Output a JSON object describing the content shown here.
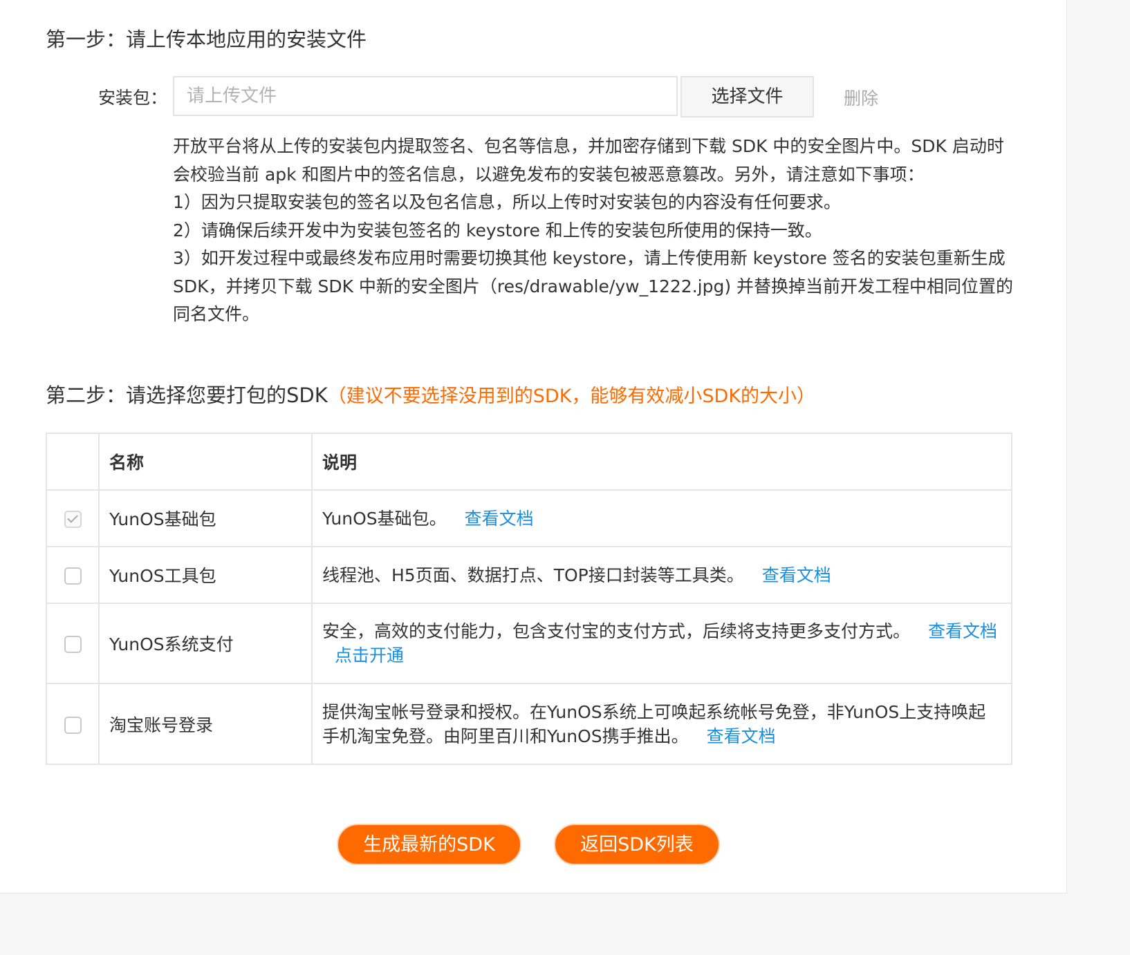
{
  "step1": {
    "title": "第一步：请上传本地应用的安装文件"
  },
  "upload": {
    "label": "安装包：",
    "placeholder": "请上传文件",
    "choose_label": "选择文件",
    "delete_label": "删除"
  },
  "description": {
    "intro": "开放平台将从上传的安装包内提取签名、包名等信息，并加密存储到下载 SDK 中的安全图片中。SDK 启动时会校验当前 apk 和图片中的签名信息，以避免发布的安装包被恶意篡改。另外，请注意如下事项：",
    "item1": "1）因为只提取安装包的签名以及包名信息，所以上传时对安装包的内容没有任何要求。",
    "item2": "2）请确保后续开发中为安装包签名的 keystore 和上传的安装包所使用的保持一致。",
    "item3": "3）如开发过程中或最终发布应用时需要切换其他 keystore，请上传使用新 keystore 签名的安装包重新生成 SDK，并拷贝下载 SDK 中新的安全图片（res/drawable/yw_1222.jpg) 并替换掉当前开发工程中相同位置的同名文件。"
  },
  "step2": {
    "title": "第二步：请选择您要打包的SDK",
    "hint": "（建议不要选择没用到的SDK，能够有效减小SDK的大小）"
  },
  "table": {
    "headers": {
      "name": "名称",
      "desc": "说明"
    },
    "rows": [
      {
        "checked": true,
        "name": "YunOS基础包",
        "desc": "YunOS基础包。",
        "doc_link": "查看文档"
      },
      {
        "checked": false,
        "name": "YunOS工具包",
        "desc": "线程池、H5页面、数据打点、TOP接口封装等工具类。",
        "doc_link": "查看文档"
      },
      {
        "checked": false,
        "name": "YunOS系统支付",
        "desc": "安全，高效的支付能力，包含支付宝的支付方式，后续将支持更多支付方式。",
        "doc_link": "查看文档",
        "extra_link": "点击开通"
      },
      {
        "checked": false,
        "name": "淘宝账号登录",
        "desc": "提供淘宝帐号登录和授权。在YunOS系统上可唤起系统帐号免登，非YunOS上支持唤起手机淘宝免登。由阿里百川和YunOS携手推出。",
        "doc_link": "查看文档"
      }
    ]
  },
  "actions": {
    "generate_label": "生成最新的SDK",
    "back_label": "返回SDK列表"
  },
  "colors": {
    "accent": "#ff6a00",
    "link": "#1a8fe0"
  }
}
